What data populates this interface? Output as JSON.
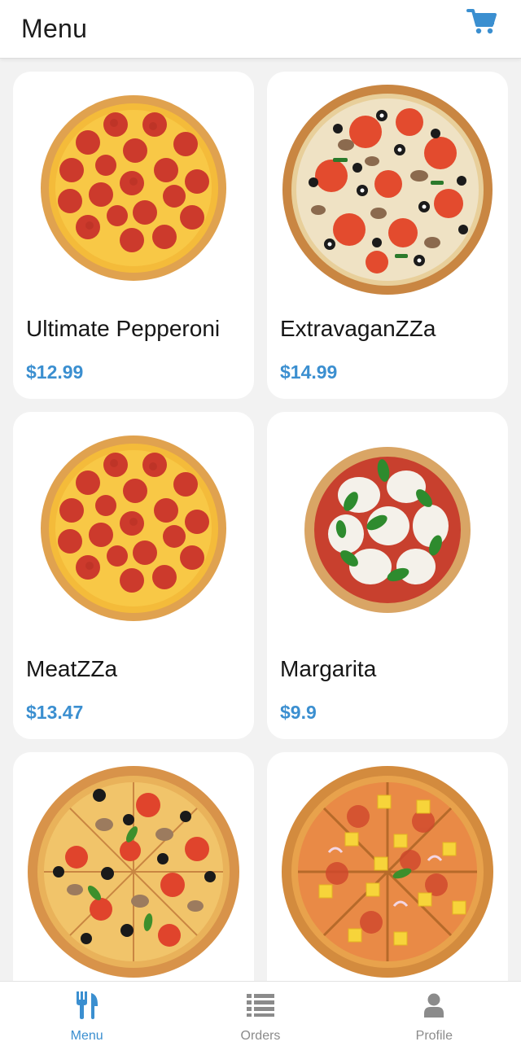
{
  "header": {
    "title": "Menu",
    "cart_icon": "cart-icon"
  },
  "menu": {
    "items": [
      {
        "name": "Ultimate Pepperoni",
        "price": "$12.99",
        "image": "pepperoni-pizza"
      },
      {
        "name": "ExtravaganZZa",
        "price": "$14.99",
        "image": "veggie-pizza"
      },
      {
        "name": "MeatZZa",
        "price": "$13.47",
        "image": "pepperoni-pizza"
      },
      {
        "name": "Margarita",
        "price": "$9.9",
        "image": "margherita-pizza"
      },
      {
        "name": "",
        "price": "",
        "image": "mushroom-olive-pizza"
      },
      {
        "name": "",
        "price": "",
        "image": "hawaiian-pizza"
      }
    ]
  },
  "tabbar": {
    "tabs": [
      {
        "label": "Menu",
        "icon": "fork-knife-icon",
        "active": true
      },
      {
        "label": "Orders",
        "icon": "list-icon",
        "active": false
      },
      {
        "label": "Profile",
        "icon": "person-icon",
        "active": false
      }
    ]
  },
  "colors": {
    "accent": "#3b8fd0",
    "background": "#f2f2f2",
    "card": "#ffffff",
    "text": "#161616",
    "inactive": "#8b8b8b"
  }
}
